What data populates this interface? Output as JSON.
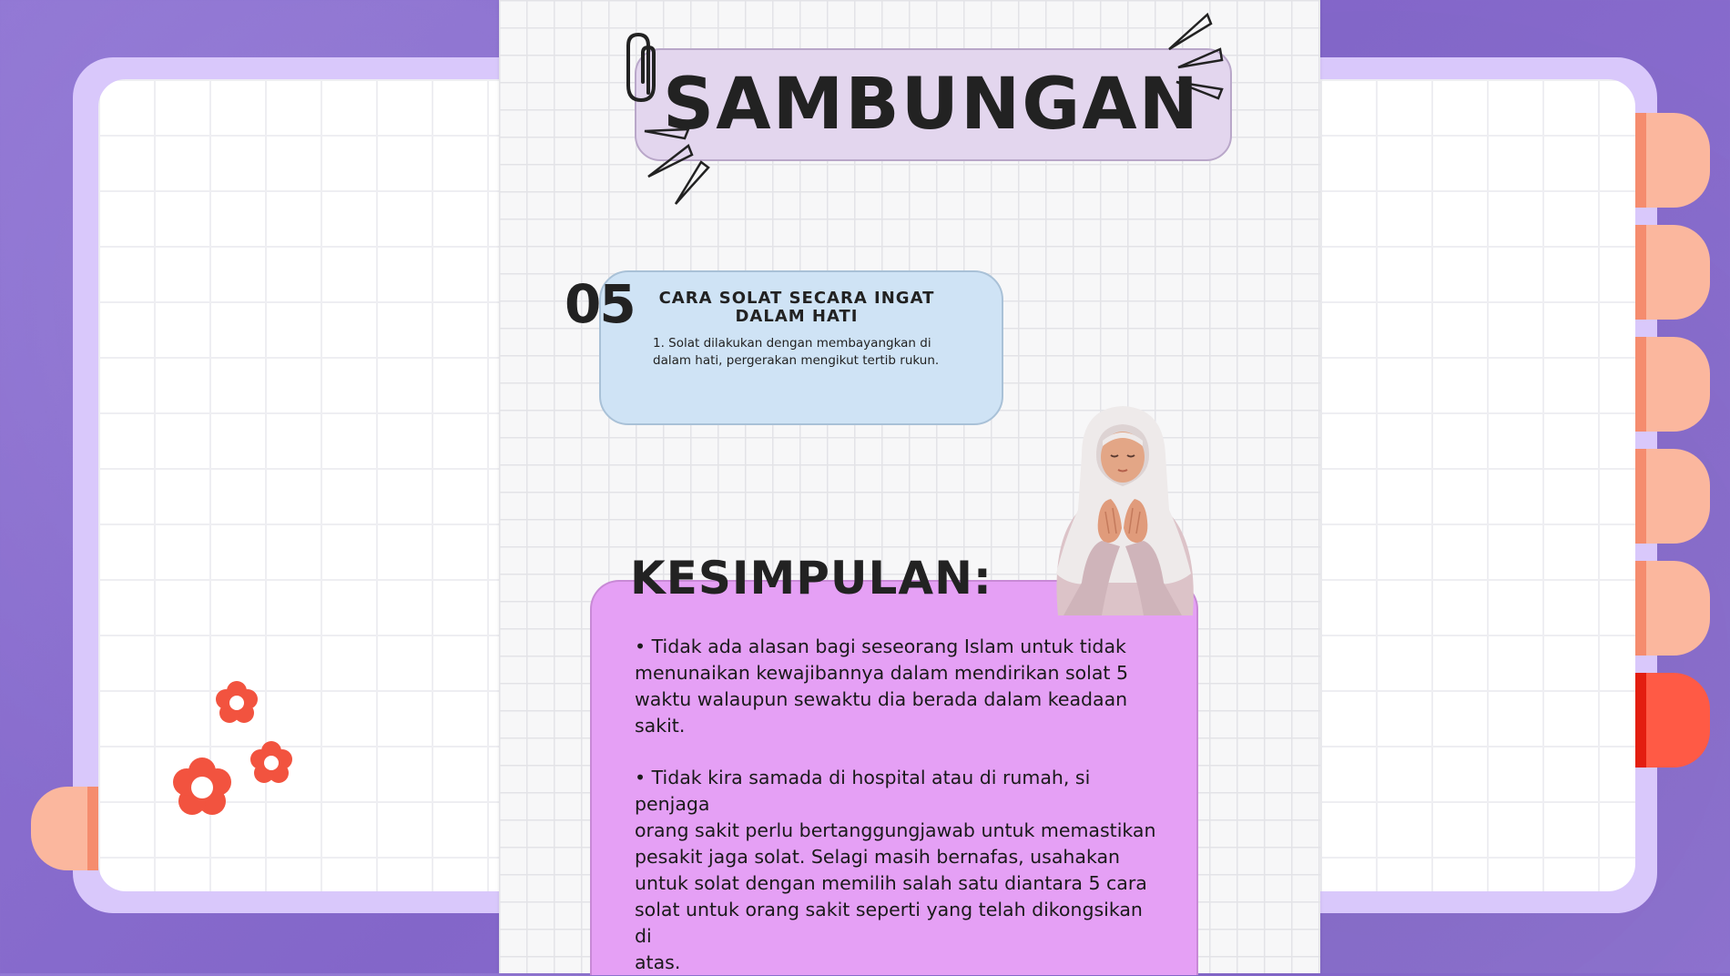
{
  "title": "SAMBUNGAN",
  "step": {
    "number": "05",
    "title_line1": "CARA SOLAT SECARA INGAT",
    "title_line2": "DALAM HATI",
    "body_line1": "1. Solat dilakukan dengan membayangkan di",
    "body_line2": "dalam hati, pergerakan mengikut tertib rukun."
  },
  "conclusion": {
    "heading": "KESIMPULAN:",
    "para1": [
      "• Tidak ada alasan bagi seseorang Islam untuk tidak",
      "menunaikan kewajibannya dalam mendirikan solat 5",
      "waktu walaupun sewaktu dia berada dalam keadaan",
      "sakit."
    ],
    "para2": [
      "• Tidak kira samada di hospital atau di rumah, si penjaga",
      "orang sakit perlu bertanggungjawab untuk memastikan",
      "pesakit jaga solat. Selagi masih bernafas, usahakan",
      "untuk solat dengan memilih salah satu diantara 5 cara",
      "solat untuk orang sakit seperti yang telah dikongsikan di",
      "atas."
    ]
  },
  "colors": {
    "background": "#8b6fcf",
    "binder": "#d9c8fb",
    "title_pill": "#e3d6ee",
    "step_card": "#cfe3f5",
    "conclusion_card": "#e5a0f5",
    "tab_light": "#fbb79e",
    "tab_active": "#ff5a45",
    "flower": "#f2533f"
  },
  "icons": [
    "paperclip-icon",
    "sparkle-lines-icon",
    "flower-icon",
    "praying-woman-illustration"
  ]
}
